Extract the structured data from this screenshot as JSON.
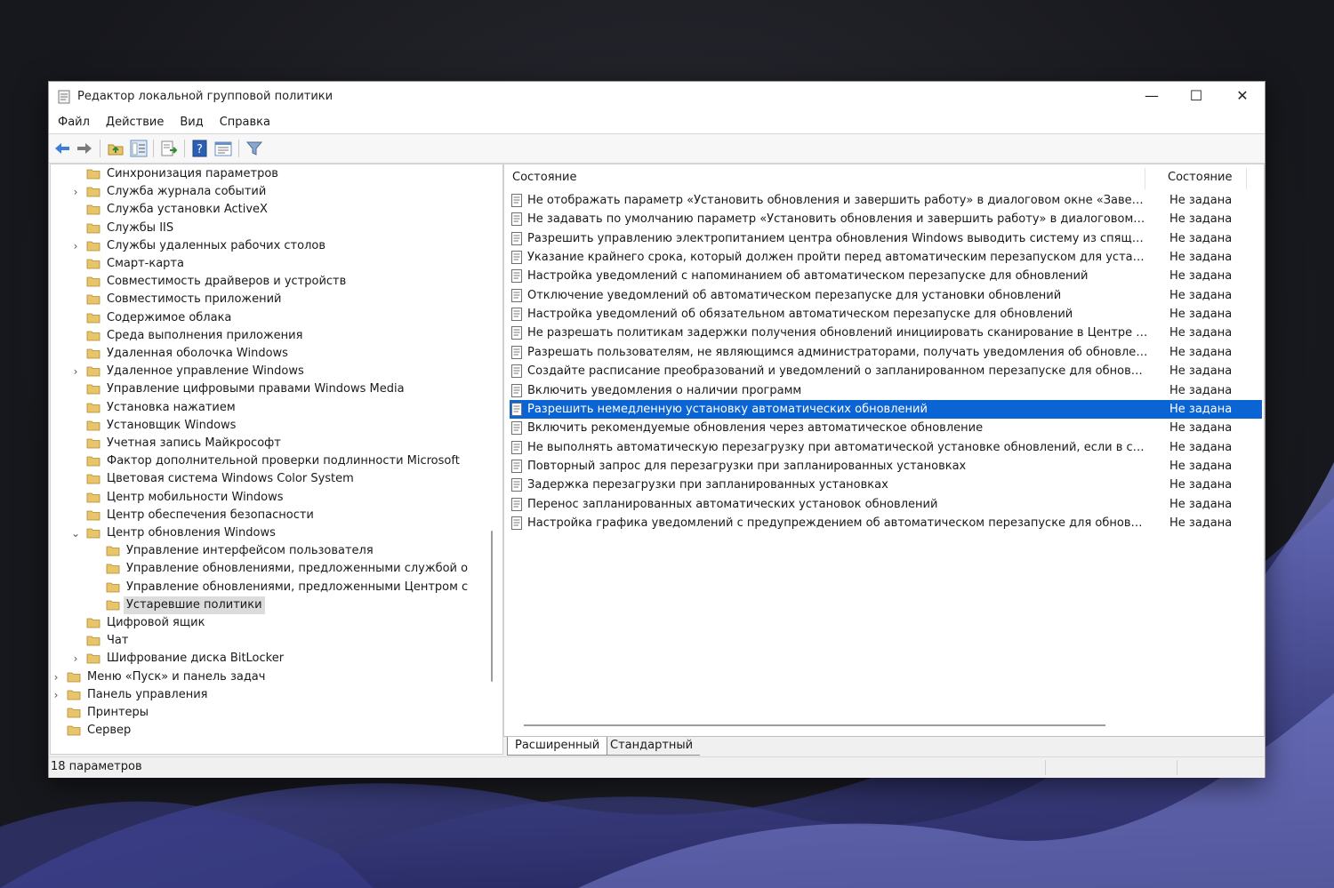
{
  "window": {
    "title": "Редактор локальной групповой политики",
    "controls": {
      "minimize": "—",
      "maximize": "☐",
      "close": "✕"
    }
  },
  "menu": [
    "Файл",
    "Действие",
    "Вид",
    "Справка"
  ],
  "toolbar": [
    "back-arrow-icon",
    "forward-arrow-icon",
    "up-folder-icon",
    "show-hide-tree-icon",
    "export-list-icon",
    "help-icon",
    "properties-icon",
    "filter-icon"
  ],
  "tree": [
    {
      "label": "Синхронизация параметров",
      "expander": ""
    },
    {
      "label": "Служба журнала событий",
      "expander": "›"
    },
    {
      "label": "Служба установки ActiveX",
      "expander": ""
    },
    {
      "label": "Службы IIS",
      "expander": ""
    },
    {
      "label": "Службы удаленных рабочих столов",
      "expander": "›"
    },
    {
      "label": "Смарт-карта",
      "expander": ""
    },
    {
      "label": "Совместимость драйверов и устройств",
      "expander": ""
    },
    {
      "label": "Совместимость приложений",
      "expander": ""
    },
    {
      "label": "Содержимое облака",
      "expander": ""
    },
    {
      "label": "Среда выполнения приложения",
      "expander": ""
    },
    {
      "label": "Удаленная оболочка Windows",
      "expander": ""
    },
    {
      "label": "Удаленное управление Windows",
      "expander": "›"
    },
    {
      "label": "Управление цифровыми правами Windows Media",
      "expander": ""
    },
    {
      "label": "Установка нажатием",
      "expander": ""
    },
    {
      "label": "Установщик Windows",
      "expander": ""
    },
    {
      "label": "Учетная запись Майкрософт",
      "expander": ""
    },
    {
      "label": "Фактор дополнительной проверки подлинности Microsoft",
      "expander": ""
    },
    {
      "label": "Цветовая система Windows Color System",
      "expander": ""
    },
    {
      "label": "Центр мобильности Windows",
      "expander": ""
    },
    {
      "label": "Центр обеспечения безопасности",
      "expander": ""
    },
    {
      "label": "Центр обновления Windows",
      "expander": "⌄"
    },
    {
      "label": "Управление интерфейсом пользователя",
      "expander": ""
    },
    {
      "label": "Управление обновлениями, предложенными службой о",
      "expander": ""
    },
    {
      "label": "Управление обновлениями, предложенными Центром с",
      "expander": ""
    },
    {
      "label": "Устаревшие политики",
      "expander": ""
    },
    {
      "label": "Цифровой ящик",
      "expander": ""
    },
    {
      "label": "Чат",
      "expander": ""
    },
    {
      "label": "Шифрование диска BitLocker",
      "expander": "›"
    },
    {
      "label": "Меню «Пуск» и панель задач",
      "expander": "›"
    },
    {
      "label": "Панель управления",
      "expander": "›"
    },
    {
      "label": "Принтеры",
      "expander": ""
    },
    {
      "label": "Сервер",
      "expander": ""
    }
  ],
  "list": {
    "columns": {
      "name": "Состояние",
      "state": "Состояние"
    },
    "rows": [
      {
        "name": "Не отображать параметр «Установить обновления и завершить работу» в диалоговом окне «Завершение раб...",
        "state": "Не задана"
      },
      {
        "name": "Не задавать по умолчанию параметр «Установить обновления и завершить работу» в диалоговом окне «Заве...",
        "state": "Не задана"
      },
      {
        "name": "Разрешить управлению электропитанием центра обновления Windows выводить систему из спящего режим...",
        "state": "Не задана"
      },
      {
        "name": "Указание крайнего срока, который должен пройти перед автоматическим перезапуском для установки обно...",
        "state": "Не задана"
      },
      {
        "name": "Настройка уведомлений с напоминанием об автоматическом перезапуске для обновлений",
        "state": "Не задана"
      },
      {
        "name": "Отключение уведомлений об автоматическом перезапуске для установки обновлений",
        "state": "Не задана"
      },
      {
        "name": "Настройка уведомлений об обязательном автоматическом перезапуске для обновлений",
        "state": "Не задана"
      },
      {
        "name": "Не разрешать политикам задержки получения обновлений инициировать сканирование в Центре обновлен...",
        "state": "Не задана"
      },
      {
        "name": "Разрешать пользователям, не являющимся администраторами, получать уведомления об обновлениях",
        "state": "Не задана"
      },
      {
        "name": "Создайте расписание преобразований и уведомлений о запланированном перезапуске для обновлений",
        "state": "Не задана"
      },
      {
        "name": "Включить уведомления о наличии программ",
        "state": "Не задана"
      },
      {
        "name": "Разрешить немедленную установку автоматических обновлений",
        "state": "Не задана"
      },
      {
        "name": "Включить рекомендуемые обновления через автоматическое обновление",
        "state": "Не задана"
      },
      {
        "name": "Не выполнять автоматическую перезагрузку при автоматической установке обновлений, если в системе раб...",
        "state": "Не задана"
      },
      {
        "name": "Повторный запрос для перезагрузки при запланированных установках",
        "state": "Не задана"
      },
      {
        "name": "Задержка перезагрузки при запланированных установках",
        "state": "Не задана"
      },
      {
        "name": "Перенос запланированных автоматических установок обновлений",
        "state": "Не задана"
      },
      {
        "name": "Настройка графика уведомлений с предупреждением об автоматическом перезапуске для обновлений",
        "state": "Не задана"
      }
    ]
  },
  "tabs": {
    "extended": "Расширенный",
    "standard": "Стандартный"
  },
  "status": {
    "text": "18 параметров"
  },
  "colors": {
    "selection": "#0b64d3",
    "folder": "#e8c46a",
    "window_bg": "#f0f0f0"
  }
}
